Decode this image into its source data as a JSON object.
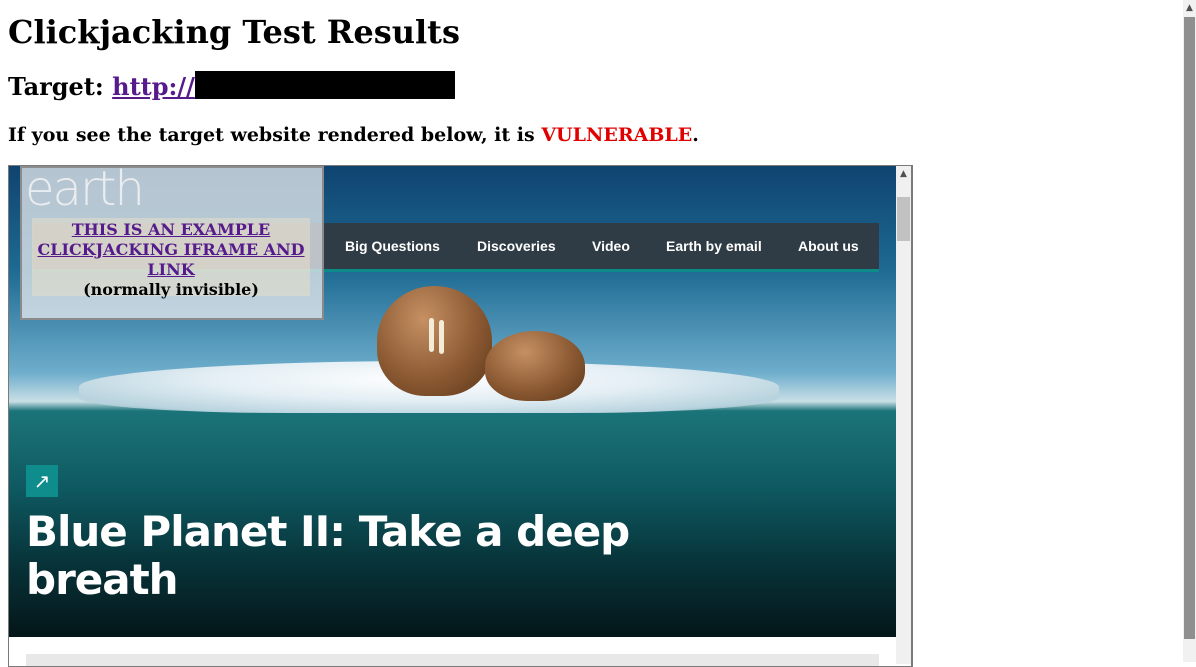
{
  "page": {
    "title": "Clickjacking Test Results",
    "target_label": "Target:",
    "target_url_prefix": "http://",
    "notice_before": "If you see the target website rendered below, it is ",
    "notice_status": "VULNERABLE",
    "notice_after": "."
  },
  "frame": {
    "logo_text": "earth",
    "nav_items": [
      "Big Questions",
      "Discoveries",
      "Video",
      "Earth by email",
      "About us"
    ],
    "headline": "Blue Planet II: Take a deep breath",
    "external_icon": "external-link-icon"
  },
  "overlay": {
    "link_text": "THIS IS AN EXAMPLE CLICKJACKING IFRAME AND LINK",
    "subtext": "(normally invisible)"
  },
  "colors": {
    "vulnerable": "#e00000",
    "link": "#551a8b",
    "nav_bg": "#2f3c45",
    "accent": "#0f8d8d"
  }
}
